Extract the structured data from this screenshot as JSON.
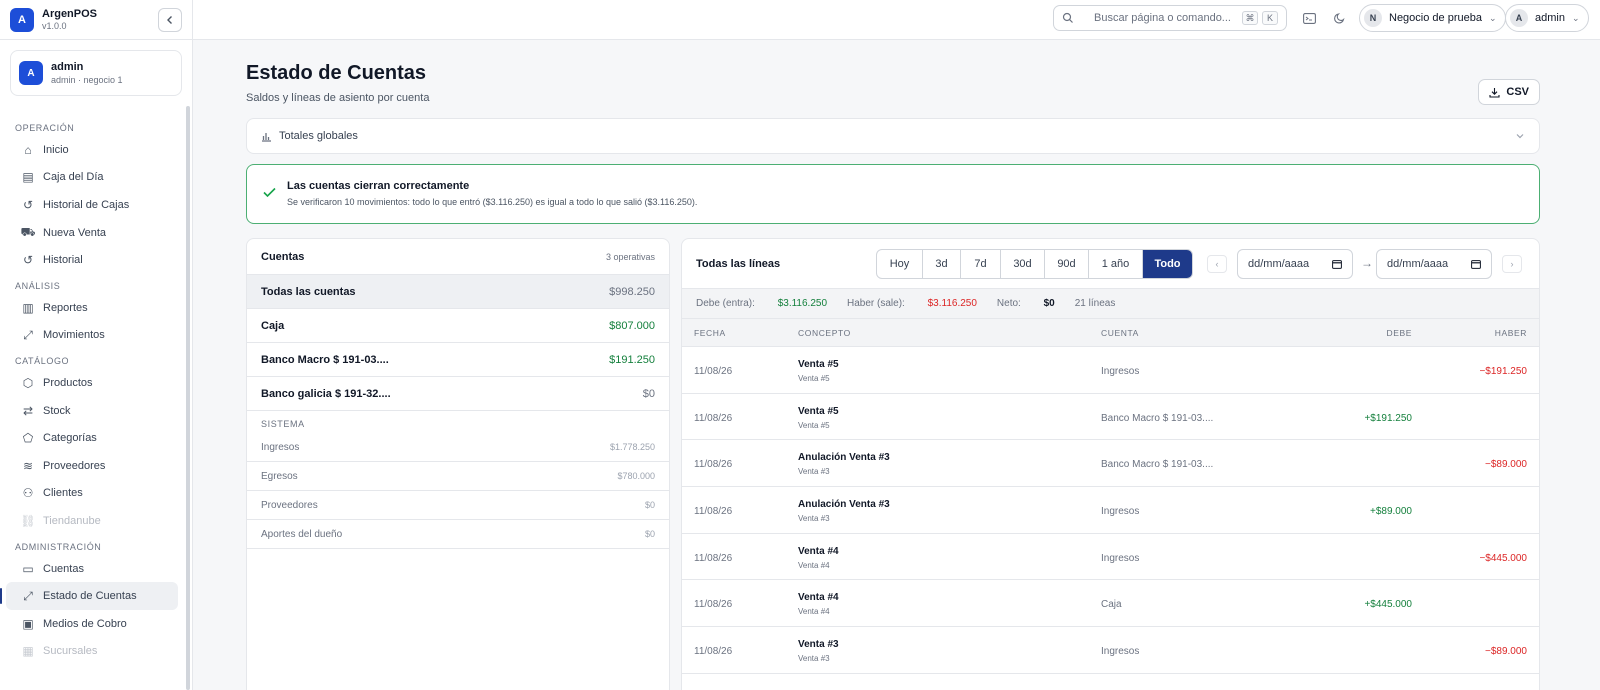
{
  "brand": {
    "name": "ArgenPOS",
    "version": "v1.0.0",
    "logo_letter": "A"
  },
  "user": {
    "name": "admin",
    "sub": "admin · negocio 1",
    "avatar_letter": "A"
  },
  "nav": {
    "sections": [
      {
        "title": "OPERACIÓN",
        "items": [
          {
            "label": "Inicio",
            "icon": "home-icon",
            "glyph": "⌂"
          },
          {
            "label": "Caja del Día",
            "icon": "receipt-icon",
            "glyph": "▤"
          },
          {
            "label": "Historial de Cajas",
            "icon": "history-icon",
            "glyph": "↺"
          },
          {
            "label": "Nueva Venta",
            "icon": "cart-icon",
            "glyph": "⛟"
          },
          {
            "label": "Historial",
            "icon": "history-icon",
            "glyph": "↺"
          }
        ]
      },
      {
        "title": "ANÁLISIS",
        "items": [
          {
            "label": "Reportes",
            "icon": "bar-chart-icon",
            "glyph": "▥"
          },
          {
            "label": "Movimientos",
            "icon": "trend-icon",
            "glyph": "⤢"
          }
        ]
      },
      {
        "title": "CATÁLOGO",
        "items": [
          {
            "label": "Productos",
            "icon": "box-icon",
            "glyph": "⬡"
          },
          {
            "label": "Stock",
            "icon": "arrows-icon",
            "glyph": "⇄"
          },
          {
            "label": "Categorías",
            "icon": "tag-icon",
            "glyph": "⬠"
          },
          {
            "label": "Proveedores",
            "icon": "layers-icon",
            "glyph": "≋"
          },
          {
            "label": "Clientes",
            "icon": "user-icon",
            "glyph": "⚇"
          },
          {
            "label": "Tiendanube",
            "icon": "link-icon",
            "glyph": "⛓",
            "muted": true
          }
        ]
      },
      {
        "title": "ADMINISTRACIÓN",
        "items": [
          {
            "label": "Cuentas",
            "icon": "card-icon",
            "glyph": "▭"
          },
          {
            "label": "Estado de Cuentas",
            "icon": "trend-icon",
            "glyph": "⤢",
            "active": true
          },
          {
            "label": "Medios de Cobro",
            "icon": "cash-icon",
            "glyph": "▣"
          },
          {
            "label": "Sucursales",
            "icon": "building-icon",
            "glyph": "▦",
            "muted": true
          }
        ]
      }
    ]
  },
  "topbar": {
    "search_placeholder": "Buscar página o comando...",
    "kbd1": "⌘",
    "kbd2": "K",
    "business": {
      "letter": "N",
      "label": "Negocio de prueba"
    },
    "account": {
      "letter": "A",
      "label": "admin"
    }
  },
  "page": {
    "title": "Estado de Cuentas",
    "subtitle": "Saldos y líneas de asiento por cuenta",
    "csv_label": "CSV",
    "totales_label": "Totales globales",
    "ok_title": "Las cuentas cierran correctamente",
    "ok_text": "Se verificaron 10 movimientos: todo lo que entró ($3.116.250) es igual a todo lo que salió ($3.116.250)."
  },
  "cuentas": {
    "title": "Cuentas",
    "count": "3 operativas",
    "rows": [
      {
        "name": "Todas las cuentas",
        "value": "$998.250",
        "tone": "grey",
        "selected": true
      },
      {
        "name": "Caja",
        "value": "$807.000",
        "tone": "green"
      },
      {
        "name": "Banco Macro $ 191-03....",
        "value": "$191.250",
        "tone": "green"
      },
      {
        "name": "Banco galicia $ 191-32....",
        "value": "$0",
        "tone": "grey"
      }
    ],
    "system_title": "SISTEMA",
    "system": [
      {
        "name": "Ingresos",
        "value": "$1.778.250"
      },
      {
        "name": "Egresos",
        "value": "$780.000"
      },
      {
        "name": "Proveedores",
        "value": "$0"
      },
      {
        "name": "Aportes del dueño",
        "value": "$0"
      }
    ]
  },
  "lineas": {
    "title": "Todas las líneas",
    "ranges": [
      "Hoy",
      "3d",
      "7d",
      "30d",
      "90d",
      "1 año",
      "Todo"
    ],
    "active_range": "Todo",
    "date_from_placeholder": "dd/mm/aaaa",
    "date_to_placeholder": "dd/mm/aaaa",
    "arrow": "→",
    "summary": {
      "debe_label": "Debe (entra):",
      "debe_value": "$3.116.250",
      "haber_label": "Haber (sale):",
      "haber_value": "$3.116.250",
      "neto_label": "Neto:",
      "neto_value": "$0",
      "lines": "21 líneas"
    },
    "columns": {
      "fecha": "FECHA",
      "concepto": "CONCEPTO",
      "cuenta": "CUENTA",
      "debe": "DEBE",
      "haber": "HABER"
    },
    "rows": [
      {
        "fecha": "11/08/26",
        "concepto": "Venta #5",
        "sub": "Venta #5",
        "cuenta": "Ingresos",
        "debe": "",
        "haber": "−$191.250"
      },
      {
        "fecha": "11/08/26",
        "concepto": "Venta #5",
        "sub": "Venta #5",
        "cuenta": "Banco Macro $ 191-03....",
        "debe": "+$191.250",
        "haber": ""
      },
      {
        "fecha": "11/08/26",
        "concepto": "Anulación Venta #3",
        "sub": "Venta #3",
        "cuenta": "Banco Macro $ 191-03....",
        "debe": "",
        "haber": "−$89.000"
      },
      {
        "fecha": "11/08/26",
        "concepto": "Anulación Venta #3",
        "sub": "Venta #3",
        "cuenta": "Ingresos",
        "debe": "+$89.000",
        "haber": ""
      },
      {
        "fecha": "11/08/26",
        "concepto": "Venta #4",
        "sub": "Venta #4",
        "cuenta": "Ingresos",
        "debe": "",
        "haber": "−$445.000"
      },
      {
        "fecha": "11/08/26",
        "concepto": "Venta #4",
        "sub": "Venta #4",
        "cuenta": "Caja",
        "debe": "+$445.000",
        "haber": ""
      },
      {
        "fecha": "11/08/26",
        "concepto": "Venta #3",
        "sub": "Venta #3",
        "cuenta": "Ingresos",
        "debe": "",
        "haber": "−$89.000"
      }
    ]
  }
}
